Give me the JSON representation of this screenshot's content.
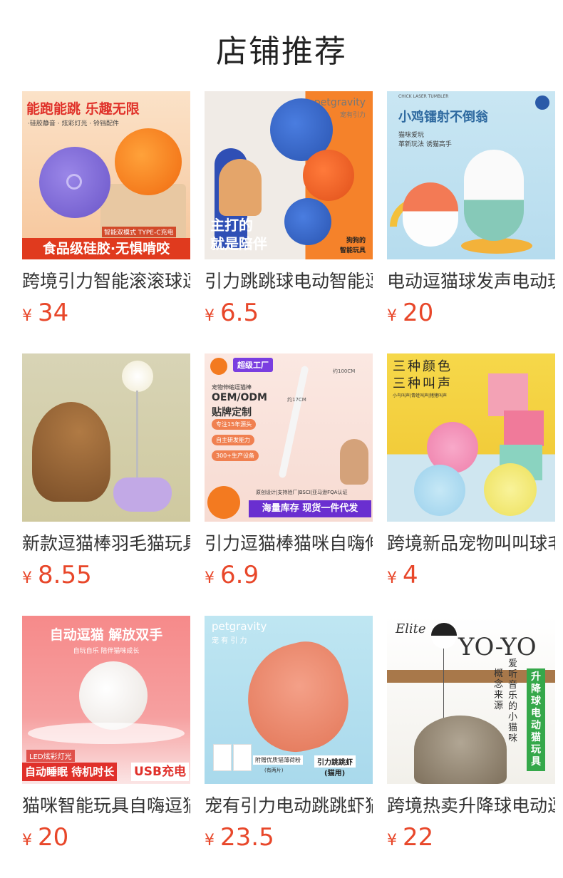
{
  "page": {
    "title": "店铺推荐"
  },
  "currency": "¥",
  "products": [
    {
      "name": "跨境引力智能滚滚球逗猫玩具",
      "price": "34",
      "image_text": {
        "headline": "能跑能跳 乐趣无限",
        "sub": "·硅胶静音 · 炫彩灯光 · 铃铛配件",
        "tag": "智能双模式 TYPE-C充电",
        "banner": "食品级硅胶·无惧啃咬"
      }
    },
    {
      "name": "引力跳跳球电动智能逗狗玩具",
      "price": "6.5",
      "image_text": {
        "brand": "petgravity",
        "brand_cn": "宠有引力",
        "headline1": "主打的",
        "headline2": "就是陪伴",
        "tag1": "狗狗的",
        "tag2": "智能玩具"
      }
    },
    {
      "name": "电动逗猫球发声电动玩具",
      "price": "20",
      "image_text": {
        "small": "CHICK LASER TUMBLER",
        "headline": "小鸡镭射不倒翁",
        "sub1": "猫咪爱玩",
        "sub2": "革新玩法 诱猫高手"
      }
    },
    {
      "name": "新款逗猫棒羽毛猫玩具",
      "price": "8.55",
      "image_text": {}
    },
    {
      "name": "引力逗猫棒猫咪自嗨伸缩",
      "price": "6.9",
      "image_text": {
        "badge": "超级工厂",
        "small": "宠物伸缩逗猫棒",
        "h1": "OEM/ODM",
        "h2": "贴牌定制",
        "p1": "专注15年源头",
        "p2": "自主研发能力",
        "p3": "300+生产设备",
        "dim1": "约17CM",
        "dim2": "约100CM",
        "cert": "原创设计|支持验厂|BSCI|亚马逊FQA认证",
        "banner": "海量库存 现货一件代发"
      }
    },
    {
      "name": "跨境新品宠物叫叫球毛绒玩具",
      "price": "4",
      "image_text": {
        "h1": "三种颜色",
        "h2": "三种叫声",
        "sub": "小鸟叫声|青蛙叫声|猪猪叫声"
      }
    },
    {
      "name": "猫咪智能玩具自嗨逗猫球",
      "price": "20",
      "image_text": {
        "headline": "自动逗猫 解放双手",
        "sub": "自玩自乐 陪伴猫咪成长",
        "led": "LED炫彩灯光",
        "banner1": "自动睡眠 待机时长",
        "banner2": "USB充电"
      }
    },
    {
      "name": "宠有引力电动跳跳虾猫玩具",
      "price": "23.5",
      "image_text": {
        "brand": "petgravity",
        "brand_cn": "宠 有 引 力",
        "tag1": "附赠优质猫薄荷粉",
        "tag1b": "(有两片)",
        "tag2": "引力跳跳虾",
        "tag2b": "(猫用)"
      }
    },
    {
      "name": "跨境热卖升降球电动逗猫器",
      "price": "22",
      "image_text": {
        "logo": "Elite",
        "headline": "YO-YO",
        "v1": "概念来源",
        "v2": "爱听音乐的小猫咪",
        "banner": "升降球电动猫玩具"
      }
    }
  ],
  "colors": {
    "accent": "#e8472a",
    "title": "#222222",
    "name": "#333333"
  }
}
